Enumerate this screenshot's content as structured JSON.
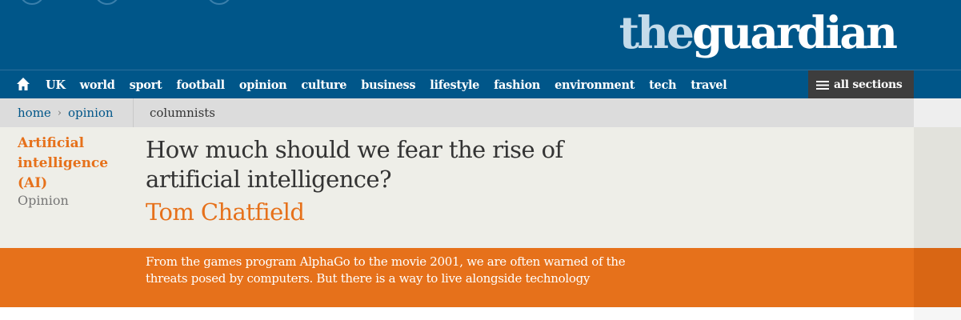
{
  "masthead": {
    "logo_the": "the",
    "logo_guardian": "guardian",
    "background": "#005689"
  },
  "nav": {
    "home_icon": "home-icon",
    "items": [
      "UK",
      "world",
      "sport",
      "football",
      "opinion",
      "culture",
      "business",
      "lifestyle",
      "fashion",
      "environment",
      "tech",
      "travel"
    ],
    "all_sections": "all sections",
    "menu_icon": "hamburger-menu-icon"
  },
  "breadcrumb": {
    "home": "home",
    "separator": "›",
    "section": "opinion",
    "series": "columnists"
  },
  "article": {
    "section_tag": "Artificial intelligence (AI)",
    "tone": "Opinion",
    "headline": "How much should we fear the rise of artificial intelligence?",
    "byline": "Tom Chatfield",
    "standfirst": "From the games program AlphaGo to the movie 2001, we are often warned of the threats posed by computers. But there is a way to live alongside technology"
  },
  "colors": {
    "brand_blue": "#005689",
    "accent_orange": "#e6711b",
    "headline_bg": "#eeeee8",
    "crumb_bg": "#dcdcdc",
    "all_sections_bg": "#3d3d3d"
  }
}
